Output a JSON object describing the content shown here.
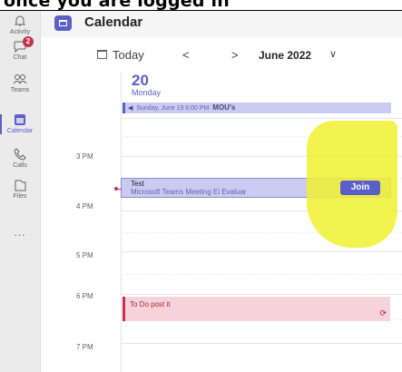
{
  "caption": "once you are logged in",
  "rail": {
    "items": [
      {
        "label": "Activity",
        "icon": "bell-icon"
      },
      {
        "label": "Chat",
        "icon": "chat-icon",
        "badge": "2"
      },
      {
        "label": "Teams",
        "icon": "teams-icon"
      },
      {
        "label": "Calendar",
        "icon": "calendar-icon",
        "active": true
      },
      {
        "label": "Calls",
        "icon": "phone-icon"
      },
      {
        "label": "Files",
        "icon": "file-icon"
      }
    ],
    "more": "..."
  },
  "header": {
    "title": "Calendar",
    "icon": "calendar-icon"
  },
  "toolbar": {
    "today_label": "Today",
    "prev": "<",
    "next": ">",
    "month": "June 2022",
    "chevron": "∨"
  },
  "day": {
    "number": "20",
    "name": "Monday"
  },
  "allday_event": {
    "prefix": "◀",
    "when": "Sunday, June 19 6:00 PM",
    "title": "MOU's"
  },
  "times": [
    "3 PM",
    "4 PM",
    "5 PM",
    "6 PM",
    "7 PM"
  ],
  "events": {
    "meeting": {
      "title": "Test",
      "subtitle": "Microsoft Teams Meeting  Ei Evaluar",
      "join": "Join"
    },
    "todo": {
      "title": "To Do post it",
      "recur_icon": "⟳"
    }
  },
  "colors": {
    "accent": "#5b5fc7",
    "event_bg": "#c9cbf2",
    "todo_bg": "#f6d3dc",
    "highlight": "#f1f131",
    "now_line": "#c4314b"
  }
}
